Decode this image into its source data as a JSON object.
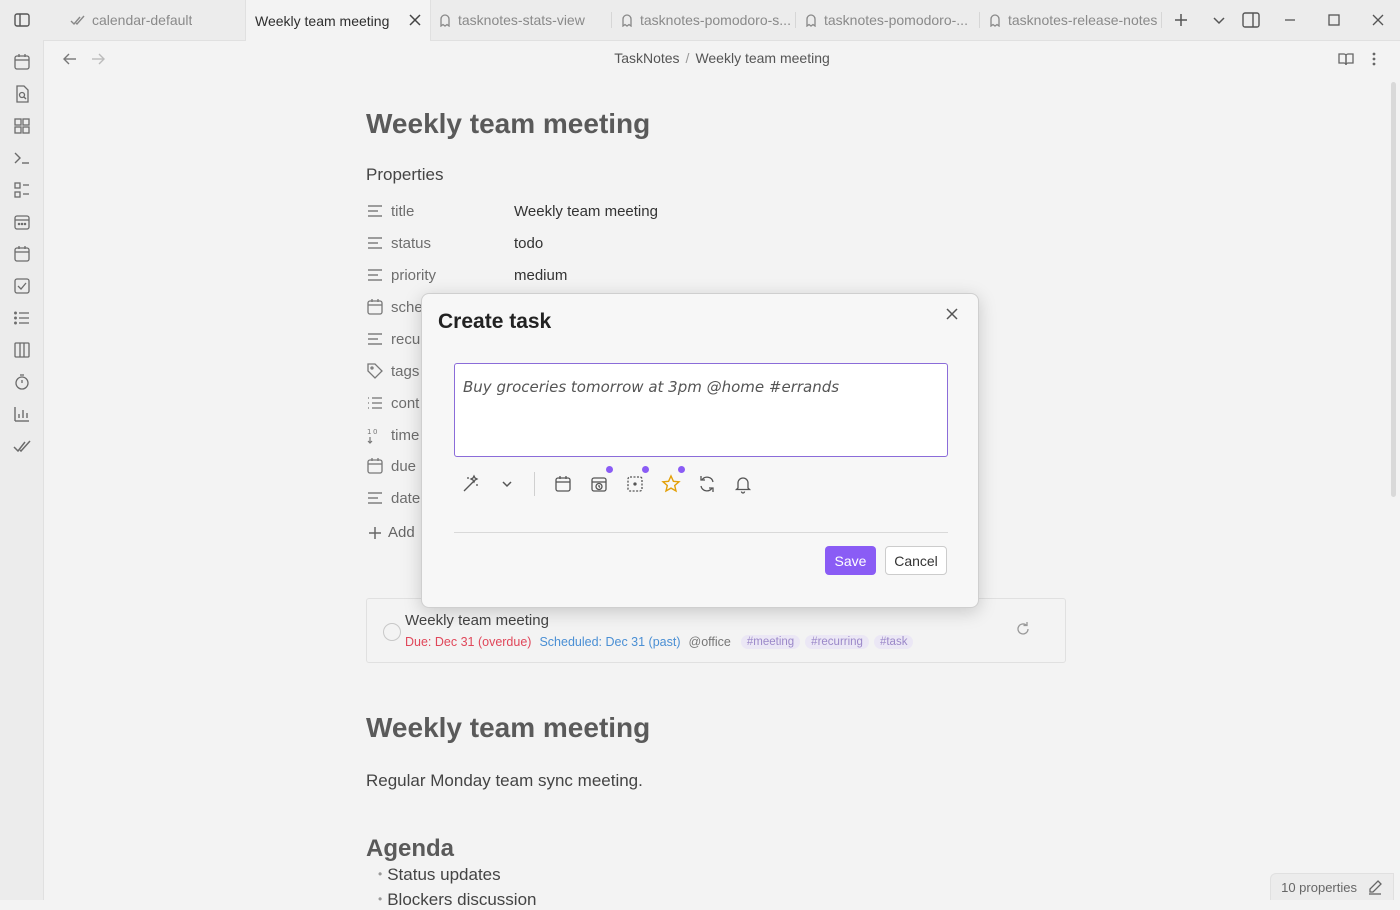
{
  "tabs": [
    {
      "label": "calendar-default",
      "icon": "check-double-icon",
      "active": false
    },
    {
      "label": "Weekly team meeting",
      "active": true
    },
    {
      "label": "tasknotes-stats-view",
      "icon": "ghost-icon",
      "active": false
    },
    {
      "label": "tasknotes-pomodoro-s...",
      "icon": "ghost-icon",
      "active": false
    },
    {
      "label": "tasknotes-pomodoro-...",
      "icon": "ghost-icon",
      "active": false
    },
    {
      "label": "tasknotes-release-notes",
      "icon": "ghost-icon",
      "active": false
    }
  ],
  "breadcrumb": {
    "folder": "TaskNotes",
    "separator": "/",
    "file": "Weekly team meeting"
  },
  "note": {
    "title": "Weekly team meeting",
    "properties_heading": "Properties",
    "properties": [
      {
        "key": "title",
        "value": "Weekly team meeting",
        "icon": "text-icon"
      },
      {
        "key": "status",
        "value": "todo",
        "icon": "text-icon"
      },
      {
        "key": "priority",
        "value": "medium",
        "icon": "text-icon"
      },
      {
        "key": "sche",
        "value": "",
        "icon": "calendar-icon"
      },
      {
        "key": "recu",
        "value": "",
        "icon": "text-icon"
      },
      {
        "key": "tags",
        "value": "",
        "icon": "tag-icon"
      },
      {
        "key": "cont",
        "value": "",
        "icon": "list-icon"
      },
      {
        "key": "time",
        "value": "",
        "icon": "number-icon"
      },
      {
        "key": "due",
        "value": "",
        "icon": "calendar-icon"
      },
      {
        "key": "date",
        "value": "",
        "icon": "text-icon"
      }
    ],
    "add_property": "Add",
    "task_card": {
      "title": "Weekly team meeting",
      "due": "Due: Dec 31 (overdue)",
      "scheduled": "Scheduled: Dec 31 (past)",
      "context": "@office",
      "tags": [
        "#meeting",
        "#recurring",
        "#task"
      ]
    },
    "heading2": "Weekly team meeting",
    "description": "Regular Monday team sync meeting.",
    "agenda_heading": "Agenda",
    "agenda": [
      "Status updates",
      "Blockers discussion"
    ]
  },
  "status_bar": {
    "properties_count": "10 properties"
  },
  "modal": {
    "title": "Create task",
    "input_value": "Buy groceries tomorrow at 3pm @home #errands",
    "save_label": "Save",
    "cancel_label": "Cancel",
    "accent_color": "#8a5cf5"
  },
  "colors": {
    "due": "#e0475a",
    "scheduled": "#4a8fd4",
    "accent": "#8a5cf5",
    "tag_bg": "#ebe7f5",
    "tag_text": "#9b88c9"
  }
}
